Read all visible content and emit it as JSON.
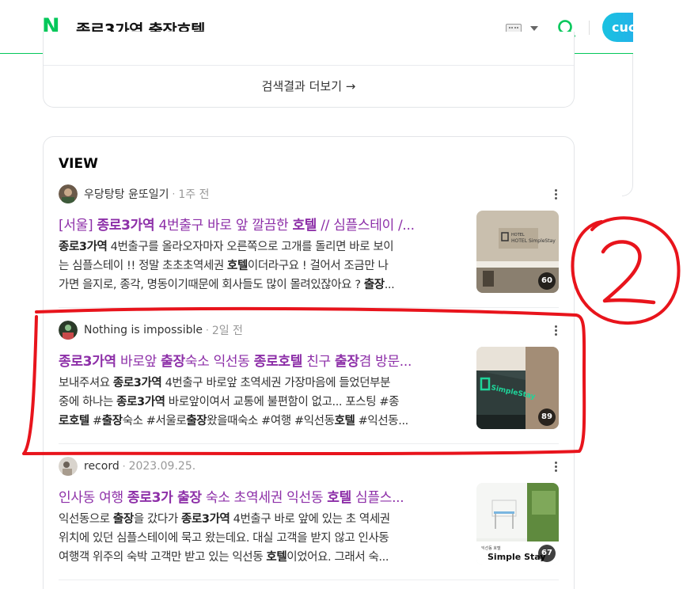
{
  "header": {
    "query": "종로3가역 출장호텔",
    "logo": "N",
    "button_label": "cuc"
  },
  "more_card": {
    "link_label": "검색결과 더보기 →"
  },
  "view": {
    "title": "VIEW",
    "posts": [
      {
        "author": "우당탕탕 윤또일기",
        "time": "1주 전",
        "title_parts": [
          "[서울] ",
          "종로3가역",
          " 4번출구 바로 앞 깔끔한 ",
          "호텔",
          " // 심플스테이 /..."
        ],
        "desc_lines": [
          [
            "종로3가역",
            " 4번출구를 올라오자마자 오른쪽으로 고개를 돌리면 바로 보이"
          ],
          [
            "는 심플스테이 !! 정말 초초초역세권 ",
            "호텔",
            "이더라구요 ! 걸어서 조금만 나"
          ],
          [
            "가면 을지로, 종각, 명동이기때문에 회사들도 많이 몰려있잖아요 ? ",
            "출장",
            "..."
          ]
        ],
        "thumb_count": "60",
        "thumb_text": "HOTEL SimpleStay"
      },
      {
        "author": "Nothing is impossible",
        "time": "2일 전",
        "title_parts": [
          "종로3가역",
          " 바로앞 ",
          "출장",
          "숙소 익선동 ",
          "종로호텔",
          " 친구 ",
          "출장",
          "겸 방문..."
        ],
        "desc_lines": [
          [
            "보내주셔요 ",
            "종로3가역",
            " 4번출구 바로앞 초역세권 가장마음에 들었던부분"
          ],
          [
            "중에 하나는 ",
            "종로3가역",
            " 바로앞이여서 교통에 불편함이 없고... 포스팅 #종"
          ],
          [
            "로호텔",
            " #",
            "출장",
            "숙소 #서울로",
            "출장",
            "왔을때숙소 #여행 #익선동",
            "호텔",
            " #익선동..."
          ]
        ],
        "thumb_count": "89",
        "thumb_text": "HOTEL SimpleStay"
      },
      {
        "author": "record",
        "time": "2023.09.25.",
        "title_parts": [
          "인사동 여행 ",
          "종로3가 출장",
          " 숙소 초역세권 익선동 ",
          "호텔",
          " 심플스..."
        ],
        "desc_lines": [
          [
            "익선동으로 ",
            "출장",
            "을 갔다가 ",
            "종로3가역",
            " 4번출구 바로 앞에 있는 초 역세권"
          ],
          [
            "위치에 있던 심플스테이에 묵고 왔는데요. 대실 고객을 받지 않고 인사동"
          ],
          [
            "여행객 위주의 숙박 고객만 받고 있는 익선동 ",
            "호텔",
            "이었어요. 그래서 숙..."
          ]
        ],
        "thumb_count": "67",
        "thumb_text": "Simple Stay",
        "thumb_subtext": "익선동 호텔"
      }
    ]
  },
  "annotation": {
    "label": "2",
    "color": "#e8141c"
  }
}
